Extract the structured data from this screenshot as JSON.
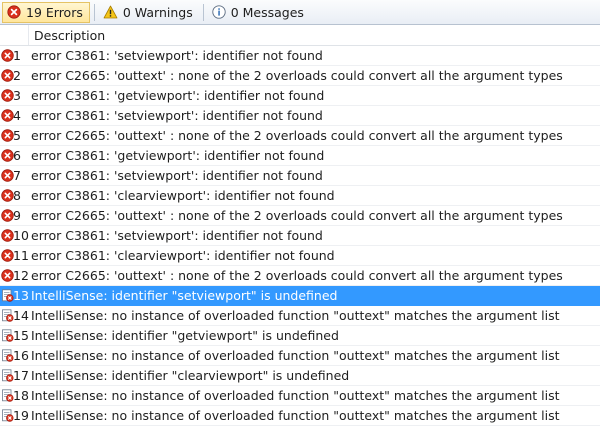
{
  "toolbar": {
    "errors_label": "19 Errors",
    "warnings_label": "0 Warnings",
    "messages_label": "0 Messages"
  },
  "header": {
    "description": "Description"
  },
  "rows": [
    {
      "num": "1",
      "kind": "error",
      "text": "error C3861: 'setviewport': identifier not found"
    },
    {
      "num": "2",
      "kind": "error",
      "text": "error C2665: 'outtext' : none of the 2 overloads could convert all the argument types"
    },
    {
      "num": "3",
      "kind": "error",
      "text": "error C3861: 'getviewport': identifier not found"
    },
    {
      "num": "4",
      "kind": "error",
      "text": "error C3861: 'setviewport': identifier not found"
    },
    {
      "num": "5",
      "kind": "error",
      "text": "error C2665: 'outtext' : none of the 2 overloads could convert all the argument types"
    },
    {
      "num": "6",
      "kind": "error",
      "text": "error C3861: 'getviewport': identifier not found"
    },
    {
      "num": "7",
      "kind": "error",
      "text": "error C3861: 'setviewport': identifier not found"
    },
    {
      "num": "8",
      "kind": "error",
      "text": "error C3861: 'clearviewport': identifier not found"
    },
    {
      "num": "9",
      "kind": "error",
      "text": "error C2665: 'outtext' : none of the 2 overloads could convert all the argument types"
    },
    {
      "num": "10",
      "kind": "error",
      "text": "error C3861: 'setviewport': identifier not found"
    },
    {
      "num": "11",
      "kind": "error",
      "text": "error C3861: 'clearviewport': identifier not found"
    },
    {
      "num": "12",
      "kind": "error",
      "text": "error C2665: 'outtext' : none of the 2 overloads could convert all the argument types"
    },
    {
      "num": "13",
      "kind": "intellisense",
      "selected": true,
      "text": "IntelliSense: identifier \"setviewport\" is undefined"
    },
    {
      "num": "14",
      "kind": "intellisense",
      "text": "IntelliSense: no instance of overloaded function \"outtext\" matches the argument list"
    },
    {
      "num": "15",
      "kind": "intellisense",
      "text": "IntelliSense: identifier \"getviewport\" is undefined"
    },
    {
      "num": "16",
      "kind": "intellisense",
      "text": "IntelliSense: no instance of overloaded function \"outtext\" matches the argument list"
    },
    {
      "num": "17",
      "kind": "intellisense",
      "text": "IntelliSense: identifier \"clearviewport\" is undefined"
    },
    {
      "num": "18",
      "kind": "intellisense",
      "text": "IntelliSense: no instance of overloaded function \"outtext\" matches the argument list"
    },
    {
      "num": "19",
      "kind": "intellisense",
      "text": "IntelliSense: no instance of overloaded function \"outtext\" matches the argument list"
    }
  ],
  "colors": {
    "error_red": "#d9301c",
    "selection": "#3399ff",
    "warning_yellow": "#f5c518",
    "info_blue": "#2f6db5"
  }
}
